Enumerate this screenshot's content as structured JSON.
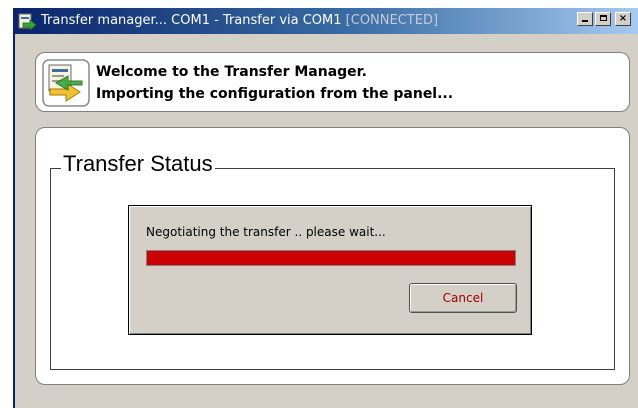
{
  "window": {
    "title": "Transfer manager... COM1 - Transfer via COM1 ",
    "status_suffix": "[CONNECTED]",
    "icons": [
      "transfer-app-icon",
      "minimize-icon",
      "maximize-icon",
      "close-icon"
    ]
  },
  "welcome": {
    "line1": "Welcome to the Transfer Manager.",
    "line2": "Importing the configuration from the panel...",
    "icon": "transfer-arrows-icon"
  },
  "status": {
    "legend": "Transfer Status",
    "message": "Negotiating the transfer .. please wait...",
    "progress": 1.0,
    "cancel_label": "Cancel"
  },
  "colors": {
    "title_bar_start": "#0a246a",
    "title_bar_end": "#a6caf0",
    "progress_fill": "#cc0000",
    "cancel_text": "#990000",
    "window_face": "#d4d0c8"
  }
}
